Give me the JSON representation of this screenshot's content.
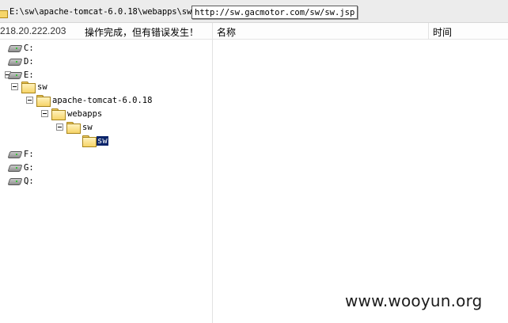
{
  "toolbar": {
    "path": "E:\\sw\\apache-tomcat-6.0.18\\webapps\\sw\\",
    "url": "http://sw.gacmotor.com/sw/sw.jsp"
  },
  "header": {
    "ip": "218.20.222.203",
    "status": "操作完成，但有错误发生！",
    "col_name": "名称",
    "col_time": "时间"
  },
  "tree": {
    "drive_c": "C:",
    "drive_d": "D:",
    "drive_e": "E:",
    "folder_sw": "sw",
    "folder_tomcat": "apache-tomcat-6.0.18",
    "folder_webapps": "webapps",
    "folder_sw2": "sw",
    "folder_sw3": "sw",
    "drive_f": "F:",
    "drive_g": "G:",
    "drive_q": "Q:"
  },
  "watermark": "www.wooyun.org"
}
